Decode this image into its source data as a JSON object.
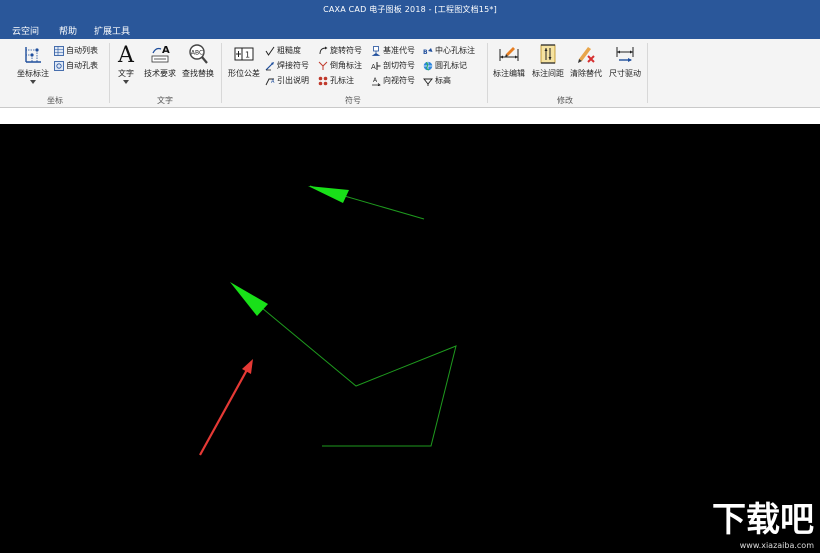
{
  "window": {
    "title": "CAXA CAD 电子图板 2018 - [工程图文档15*]"
  },
  "menu": [
    "云空间",
    "帮助",
    "扩展工具"
  ],
  "ribbon": {
    "coord": {
      "label": "坐标",
      "coord_mark": "坐标标注",
      "auto_list": "自动列表",
      "auto_hole": "自动孔表"
    },
    "text": {
      "label": "文字",
      "text_btn": "文字",
      "tech_req": "技术要求",
      "find_replace": "查找替换"
    },
    "symbol": {
      "label": "符号",
      "tolerance": "形位公差",
      "roughness": "粗糙度",
      "weld": "焊接符号",
      "leader": "引出说明",
      "rotate": "旋转符号",
      "chamfer": "倒角标注",
      "hole": "孔标注",
      "datum": "基准代号",
      "section": "剖切符号",
      "view": "向视符号",
      "center_hole": "中心孔标注",
      "circle_hole": "圆孔标记",
      "elevation": "标高"
    },
    "modify": {
      "label": "修改",
      "edit": "标注编辑",
      "spacing": "标注间距",
      "clear_replace": "清除替代",
      "drive": "尺寸驱动"
    }
  },
  "watermark": {
    "text": "下载吧",
    "url": "www.xiazaiba.com"
  }
}
